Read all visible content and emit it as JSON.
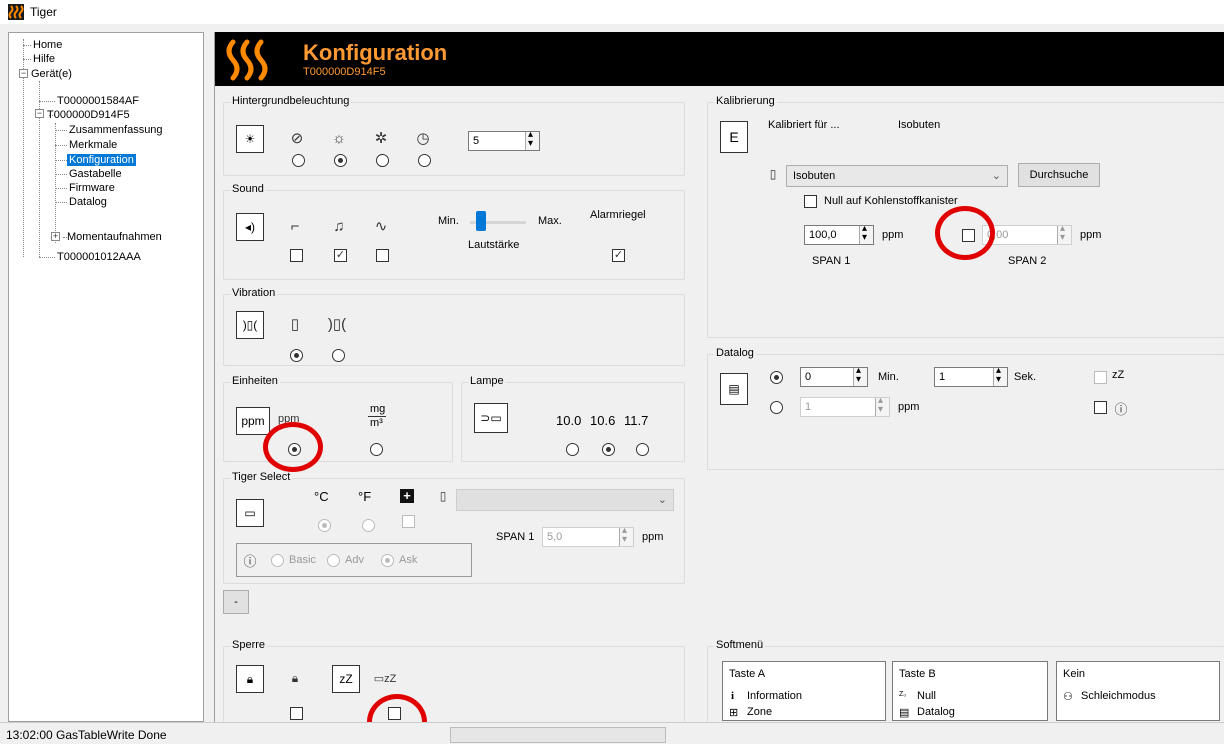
{
  "window": {
    "title": "Tiger"
  },
  "tree": {
    "items": [
      {
        "label": "Home"
      },
      {
        "label": "Hilfe"
      },
      {
        "label": "Gerät(e)"
      },
      {
        "label": "T0000001584AF"
      },
      {
        "label": "T000000D914F5"
      },
      {
        "label": "Zusammenfassung"
      },
      {
        "label": "Merkmale"
      },
      {
        "label": "Konfiguration"
      },
      {
        "label": "Gastabelle"
      },
      {
        "label": "Firmware"
      },
      {
        "label": "Datalog"
      },
      {
        "label": "Momentaufnahmen"
      },
      {
        "label": "T000001012AAA"
      }
    ],
    "expander_minus": "−",
    "expander_plus": "+"
  },
  "header": {
    "title": "Konfiguration",
    "serial": "T000000D914F5"
  },
  "backlight": {
    "label": "Hintergrundbeleuchtung",
    "spin_value": "5",
    "selected_index": 1
  },
  "sound": {
    "label": "Sound",
    "min_label": "Min.",
    "max_label": "Max.",
    "volume_label": "Lautstärke",
    "alarm_latch_label": "Alarmriegel",
    "checks": [
      false,
      true,
      false
    ],
    "alarm_latch_checked": true
  },
  "vibration": {
    "label": "Vibration",
    "selected_index": 0
  },
  "units": {
    "label": "Einheiten",
    "ppm_box": "ppm",
    "ppm_label": "ppm",
    "mg_label": "mg",
    "m3_label": "m³",
    "selected_index": 0
  },
  "lamp": {
    "label": "Lampe",
    "options": [
      "10.0",
      "10.6",
      "11.7"
    ],
    "selected_index": 1
  },
  "tiger_select": {
    "label": "Tiger Select",
    "celsius": "°C",
    "fahrenheit": "°F",
    "span1_label": "SPAN 1",
    "span1_value": "5,0",
    "ppm": "ppm",
    "modes": [
      "Basic",
      "Adv",
      "Ask"
    ],
    "mode_selected": 2
  },
  "minus_button": "-",
  "lock": {
    "label": "Sperre"
  },
  "calibration": {
    "label": "Kalibrierung",
    "box_letter": "E",
    "calibrated_for_label": "Kalibriert für ...",
    "calibrated_for_value": "Isobuten",
    "gas_select": "Isobuten",
    "browse_button": "Durchsuche",
    "zero_carbon_label": "Null auf Kohlenstoffkanister",
    "span1_value": "100,0",
    "span2_value": "0,00",
    "ppm": "ppm",
    "span1_label": "SPAN 1",
    "span2_label": "SPAN 2"
  },
  "datalog": {
    "label": "Datalog",
    "interval_min": "0",
    "min_label": "Min.",
    "interval_sec": "1",
    "sec_label": "Sek.",
    "threshold_value": "1",
    "ppm": "ppm",
    "sleep_icon_text": "zZ",
    "selected_index": 0
  },
  "softmenu": {
    "label": "Softmenü",
    "cards": [
      {
        "title": "Taste A",
        "items": [
          "Information",
          "Zone"
        ]
      },
      {
        "title": "Taste B",
        "items": [
          "Null",
          "Datalog"
        ]
      },
      {
        "title": "Kein",
        "items": [
          "Schleichmodus"
        ]
      }
    ]
  },
  "status": {
    "message": "13:02:00 GasTableWrite Done"
  },
  "colors": {
    "header_bg": "#000000",
    "header_fg": "#ff9933",
    "selection": "#0078d7",
    "marker": "#e00000"
  }
}
